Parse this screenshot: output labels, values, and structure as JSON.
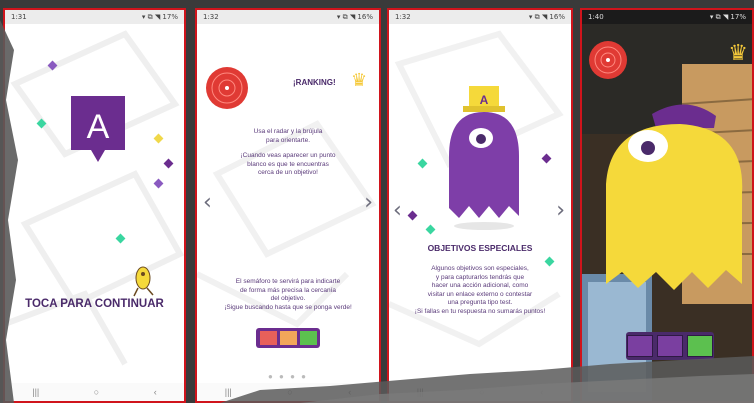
{
  "screens": [
    {
      "status": {
        "time": "1:31",
        "right": "▾ ⧉ ◥ 17%"
      },
      "logo_letter": "A",
      "cta": "TOCA PARA CONTINUAR"
    },
    {
      "status": {
        "time": "1:32",
        "right": "▾ ⧉ ◥ 16%"
      },
      "ranking_label": "¡RANKING!",
      "text1": [
        "Usa el radar y la brújula",
        "para orientarte."
      ],
      "text2": [
        "¡Cuando veas aparecer un punto",
        "blanco es que te encuentras",
        "cerca de un objetivo!"
      ],
      "text3": [
        "El semáforo te servirá para indicarte",
        "de forma más precisa la cercanía",
        "del objetivo.",
        "¡Sigue buscando hasta que se ponga verde!"
      ],
      "semaforo": [
        "#e8605a",
        "#f2a65a",
        "#5cc04f"
      ],
      "prev": "‹",
      "next": "›"
    },
    {
      "status": {
        "time": "1:32",
        "right": "▾ ⧉ ◥ 16%"
      },
      "hat_letter": "A",
      "title": "OBJETIVOS ESPECIALES",
      "text": [
        "Algunos objetivos son especiales,",
        "y para capturarlos tendrás que",
        "hacer una acción adicional, como",
        "visitar un enlace externo o contestar",
        "una pregunta tipo test.",
        "¡Si fallas en tu respuesta no sumarás puntos!"
      ],
      "prev": "‹",
      "next": "›"
    },
    {
      "status": {
        "time": "1:40",
        "right": "▾ ⧉ ◥ 17%"
      },
      "semaforo": [
        "#7a3fa0",
        "#7a3fa0",
        "#5cc04f"
      ]
    }
  ],
  "nav_icons": [
    "|||",
    "○",
    "‹"
  ],
  "colors": {
    "purple": "#6b2d8f",
    "accent_red": "#e03a34",
    "yellow": "#f5d93a"
  }
}
